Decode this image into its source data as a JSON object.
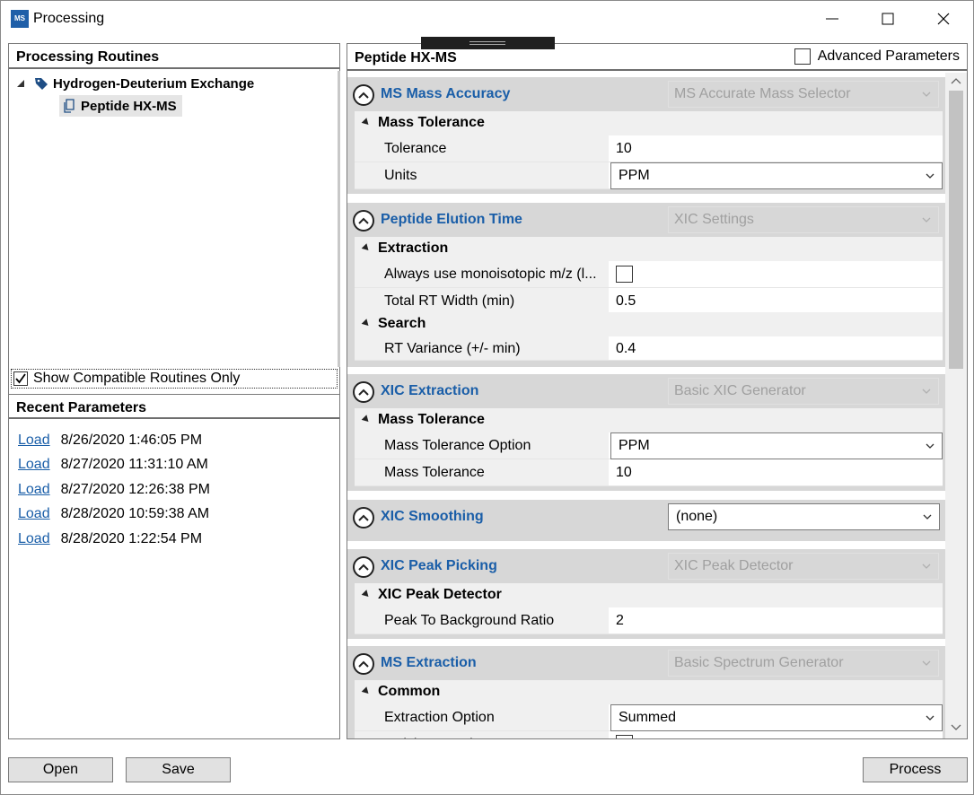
{
  "window": {
    "title": "Processing",
    "app_icon_text": "MS"
  },
  "left": {
    "routines_header": "Processing Routines",
    "tree": [
      {
        "label": "Hydrogen-Deuterium Exchange"
      },
      {
        "label": "Peptide HX-MS"
      }
    ],
    "compatible_label": "Show Compatible Routines Only",
    "compatible_checked": true,
    "recent_header": "Recent Parameters",
    "load_label": "Load",
    "recent": [
      "8/26/2020 1:46:05 PM",
      "8/27/2020 11:31:10 AM",
      "8/27/2020 12:26:38 PM",
      "8/28/2020 10:59:38 AM",
      "8/28/2020 1:22:54 PM"
    ]
  },
  "right": {
    "title": "Peptide HX-MS",
    "advanced_label": "Advanced Parameters",
    "sections": {
      "ms_mass_accuracy": {
        "title": "MS Mass Accuracy",
        "selector": "MS Accurate Mass Selector",
        "group": "Mass Tolerance",
        "rows": [
          {
            "name": "Tolerance",
            "value": "10"
          },
          {
            "name": "Units",
            "value": "PPM"
          }
        ]
      },
      "peptide_elution": {
        "title": "Peptide Elution Time",
        "selector": "XIC Settings",
        "group1": "Extraction",
        "rows1": [
          {
            "name": "Always use monoisotopic m/z (l...",
            "value": ""
          },
          {
            "name": "Total RT Width (min)",
            "value": "0.5"
          }
        ],
        "group2": "Search",
        "rows2": [
          {
            "name": "RT Variance (+/- min)",
            "value": "0.4"
          }
        ]
      },
      "xic_extraction": {
        "title": "XIC Extraction",
        "selector": "Basic XIC Generator",
        "group": "Mass Tolerance",
        "rows": [
          {
            "name": "Mass Tolerance Option",
            "value": "PPM"
          },
          {
            "name": "Mass Tolerance",
            "value": "10"
          }
        ]
      },
      "xic_smoothing": {
        "title": "XIC Smoothing",
        "selector": "(none)"
      },
      "xic_peak_picking": {
        "title": "XIC Peak Picking",
        "selector": "XIC Peak Detector",
        "group": "XIC Peak Detector",
        "rows": [
          {
            "name": "Peak To Background Ratio",
            "value": "2"
          }
        ]
      },
      "ms_extraction": {
        "title": "MS Extraction",
        "selector": "Basic Spectrum Generator",
        "group": "Common",
        "rows": [
          {
            "name": "Extraction Option",
            "value": "Summed"
          },
          {
            "name": "Quick Extraction",
            "value": ""
          }
        ]
      }
    }
  },
  "buttons": {
    "open": "Open",
    "save": "Save",
    "process": "Process"
  },
  "colors": {
    "accent": "#1a5ea8",
    "section_bg": "#d7d7d7",
    "disabled_text": "#a0a0a0"
  }
}
